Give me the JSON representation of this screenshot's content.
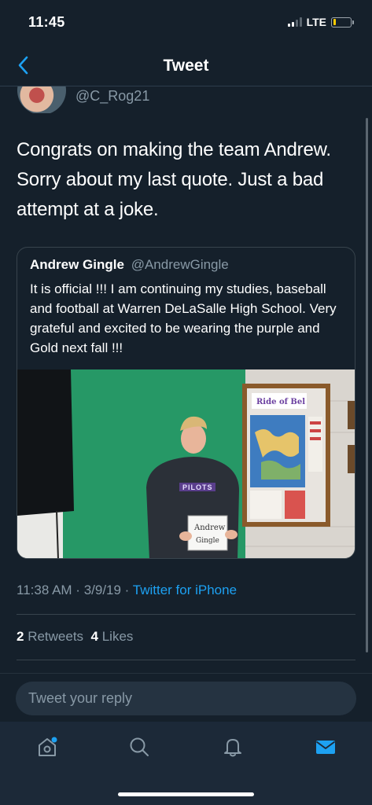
{
  "status": {
    "time": "11:45",
    "network": "LTE",
    "battery_level": 0.15,
    "signal_bars": 2
  },
  "nav": {
    "title": "Tweet",
    "back_icon": "chevron-left-icon"
  },
  "tweet": {
    "handle": "@C_Rog21",
    "text": "Congrats on making the team Andrew. Sorry about my last quote. Just a bad attempt at a joke.",
    "quote": {
      "name": "Andrew Gingle",
      "handle": "@AndrewGingle",
      "text": "It is official !!!  I am continuing my studies, baseball and football at Warren DeLaSalle High School. Very grateful and excited to be wearing the purple and Gold next fall !!!",
      "media": {
        "hoodie_text": "PILOTS",
        "sign_line1": "Andrew",
        "sign_line2": "Gingle",
        "board_text": "Ride of Bel"
      }
    },
    "meta": {
      "time": "11:38 AM",
      "separator1": " · ",
      "date": "3/9/19",
      "separator2": " · ",
      "source": "Twitter for iPhone"
    },
    "stats": {
      "retweets_count": "2",
      "retweets_label": " Retweets",
      "likes_count": "4",
      "likes_label": " Likes"
    }
  },
  "reply": {
    "placeholder": "Tweet your reply"
  },
  "tabs": {
    "home": "home-icon",
    "search": "search-icon",
    "notifications": "bell-icon",
    "messages": "mail-icon"
  },
  "colors": {
    "background": "#15202b",
    "accent": "#1da1f2",
    "secondary_text": "#8899a6",
    "tab_bar": "#1c2938"
  }
}
